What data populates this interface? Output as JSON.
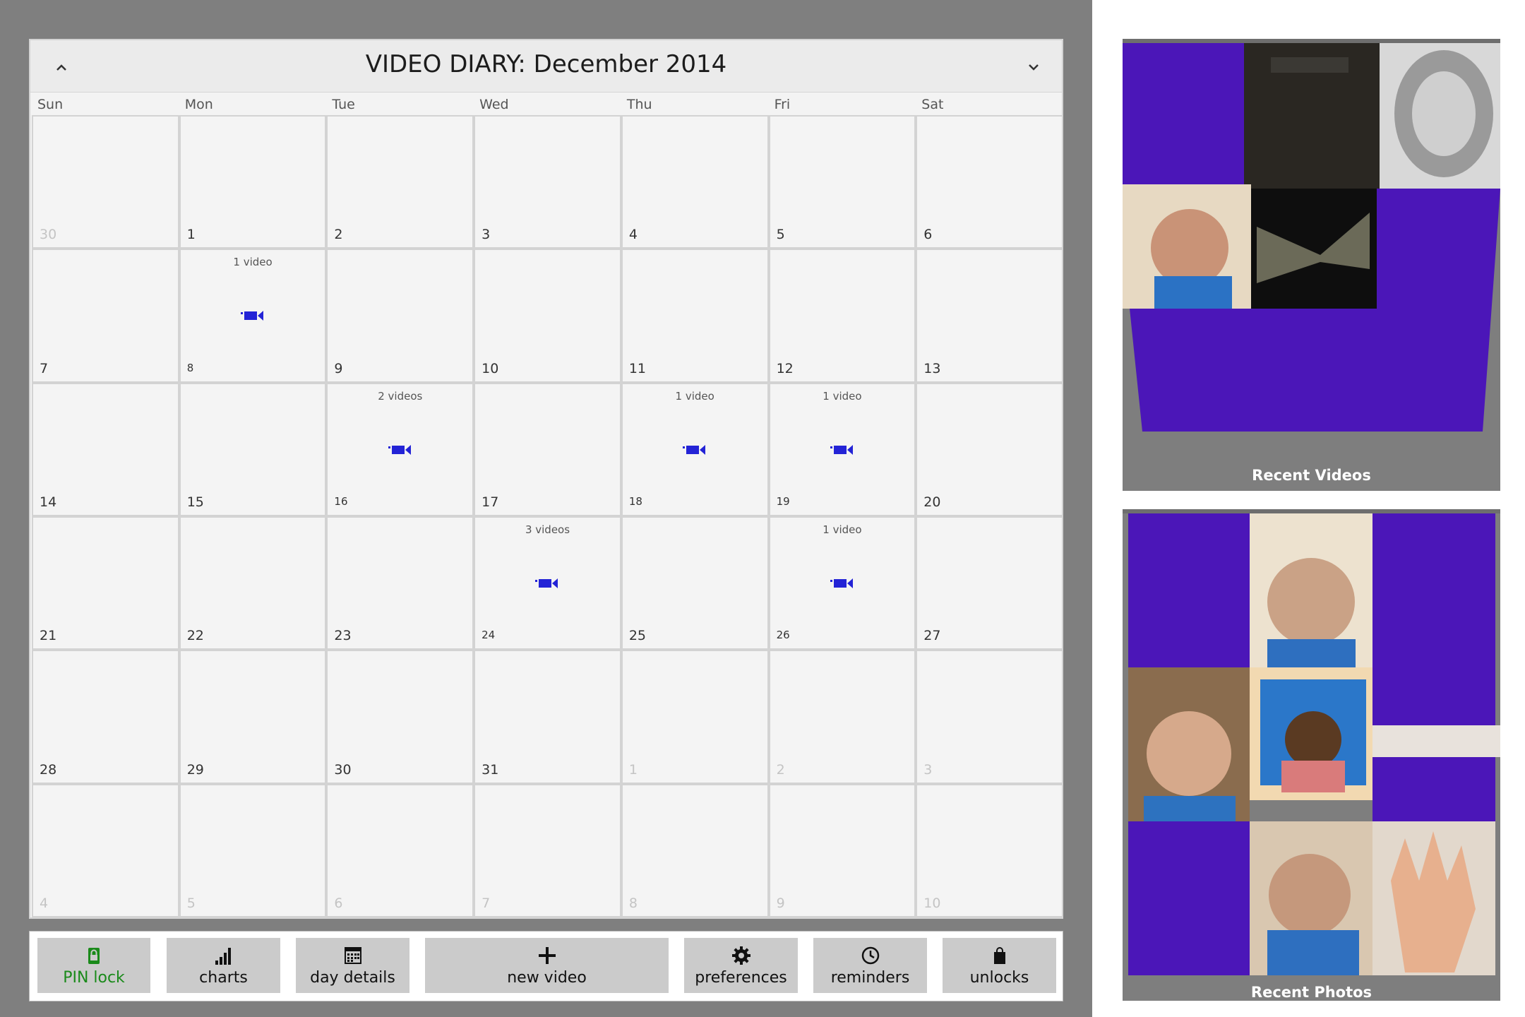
{
  "calendar": {
    "title": "VIDEO DIARY: December 2014",
    "weekdays": [
      "Sun",
      "Mon",
      "Tue",
      "Wed",
      "Thu",
      "Fri",
      "Sat"
    ],
    "days": [
      {
        "n": "30",
        "faded": true
      },
      {
        "n": "1"
      },
      {
        "n": "2"
      },
      {
        "n": "3"
      },
      {
        "n": "4"
      },
      {
        "n": "5"
      },
      {
        "n": "6"
      },
      {
        "n": "7"
      },
      {
        "n": "8",
        "videos": "1 video"
      },
      {
        "n": "9"
      },
      {
        "n": "10"
      },
      {
        "n": "11"
      },
      {
        "n": "12"
      },
      {
        "n": "13"
      },
      {
        "n": "14"
      },
      {
        "n": "15"
      },
      {
        "n": "16",
        "videos": "2 videos"
      },
      {
        "n": "17"
      },
      {
        "n": "18",
        "videos": "1 video"
      },
      {
        "n": "19",
        "videos": "1 video"
      },
      {
        "n": "20"
      },
      {
        "n": "21"
      },
      {
        "n": "22"
      },
      {
        "n": "23"
      },
      {
        "n": "24",
        "videos": "3 videos"
      },
      {
        "n": "25"
      },
      {
        "n": "26",
        "videos": "1 video"
      },
      {
        "n": "27"
      },
      {
        "n": "28"
      },
      {
        "n": "29"
      },
      {
        "n": "30"
      },
      {
        "n": "31"
      },
      {
        "n": "1",
        "faded": true
      },
      {
        "n": "2",
        "faded": true
      },
      {
        "n": "3",
        "faded": true
      },
      {
        "n": "4",
        "faded": true
      },
      {
        "n": "5",
        "faded": true
      },
      {
        "n": "6",
        "faded": true
      },
      {
        "n": "7",
        "faded": true
      },
      {
        "n": "8",
        "faded": true
      },
      {
        "n": "9",
        "faded": true
      },
      {
        "n": "10",
        "faded": true
      }
    ]
  },
  "toolbar": {
    "pin_lock": "PIN lock",
    "charts": "charts",
    "day_details": "day details",
    "new_video": "new video",
    "preferences": "preferences",
    "reminders": "reminders",
    "unlocks": "unlocks"
  },
  "panels": {
    "recent_videos": "Recent Videos",
    "recent_photos": "Recent Photos"
  },
  "colors": {
    "accent_purple": "#4b16b8",
    "video_icon_blue": "#2323d6",
    "pin_green": "#1a8a1a"
  },
  "icons": {
    "prev": "chevron-up-icon",
    "next": "chevron-down-icon",
    "video": "video-camera-icon"
  }
}
